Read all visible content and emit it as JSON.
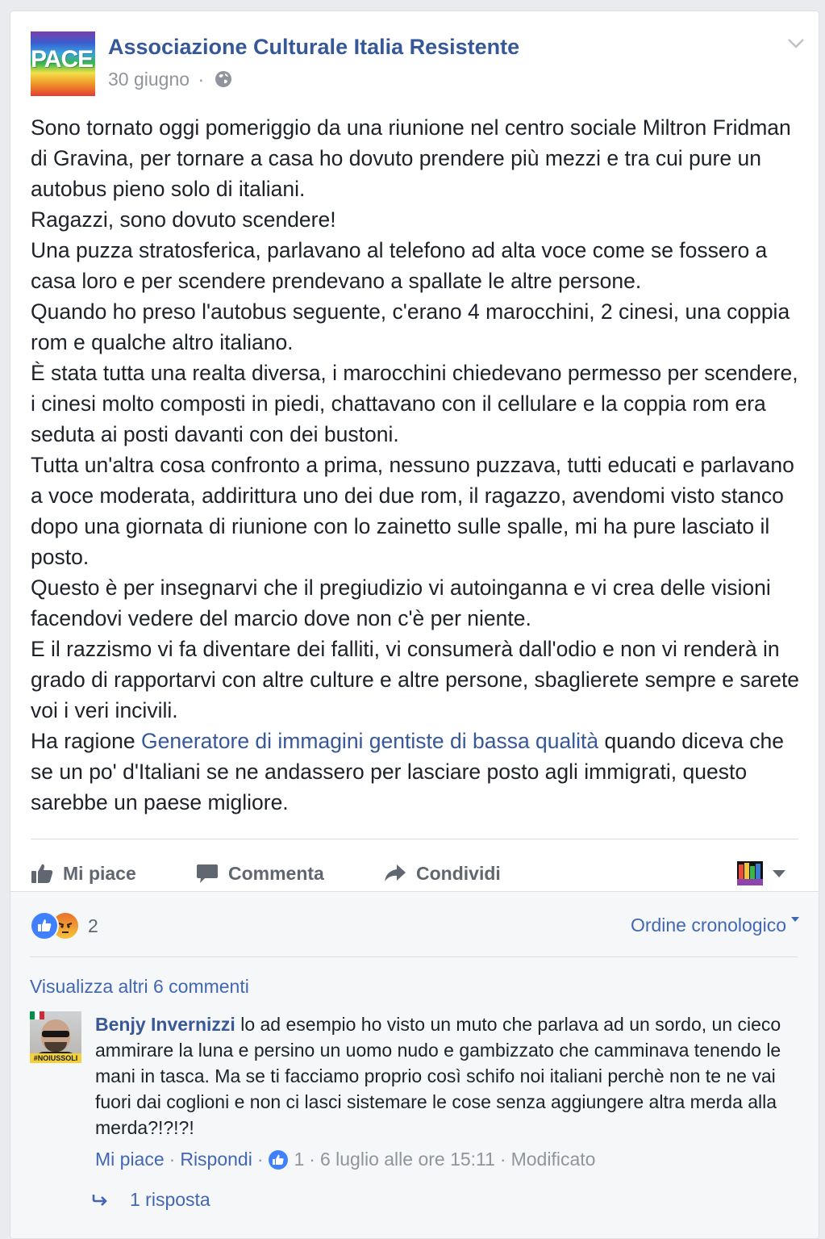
{
  "post": {
    "page_name": "Associazione Culturale Italia Resistente",
    "avatar_text": "PACE",
    "date": "30 giugno",
    "dot": "·",
    "paragraphs": [
      "Sono tornato oggi pomeriggio da una riunione nel centro sociale Miltron Fridman di Gravina, per tornare a casa ho dovuto prendere più mezzi e tra cui pure un autobus pieno solo di italiani.",
      "Ragazzi, sono dovuto scendere!",
      "Una puzza stratosferica, parlavano al telefono ad alta voce come se fossero a casa loro e per scendere prendevano a spallate le altre persone.",
      "Quando ho preso l'autobus seguente, c'erano 4 marocchini, 2 cinesi, una coppia rom e qualche altro italiano.",
      "È stata tutta una realta diversa, i marocchini chiedevano permesso per scendere, i cinesi molto composti in piedi, chattavano con il cellulare e la coppia rom era seduta ai posti davanti con dei bustoni.",
      "Tutta un'altra cosa confronto a prima, nessuno puzzava, tutti educati e parlavano a voce moderata, addirittura uno dei due rom, il ragazzo, avendomi visto stanco dopo una giornata di riunione con lo zainetto sulle spalle, mi ha pure lasciato il posto.",
      "Questo è per insegnarvi che il pregiudizio vi autoinganna e vi crea delle visioni facendovi vedere del marcio dove non c'è per niente.",
      "E il razzismo vi fa diventare dei falliti, vi consumerà dall'odio e non vi renderà in grado di rapportarvi con altre culture e altre persone, sbaglierete sempre e sarete voi i veri incivili."
    ],
    "last_paragraph": {
      "before": "Ha ragione ",
      "link": "Generatore di immagini gentiste di bassa qualità",
      "after": " quando diceva che se un po' d'Italiani se ne andassero per lasciare posto agli immigrati, questo sarebbe un paese migliore."
    }
  },
  "actions": {
    "like": "Mi piace",
    "comment": "Commenta",
    "share": "Condividi"
  },
  "reactions": {
    "count": "2",
    "order": "Ordine cronologico"
  },
  "comments_section": {
    "view_more": "Visualizza altri 6 commenti",
    "comment": {
      "author": "Benjy Invernizzi",
      "avatar_tag": "#NOIUSSOLI",
      "text": " lo ad esempio ho visto un muto che parlava ad un sordo, un cieco ammirare la luna e persino un uomo nudo e gambizzato che camminava tenendo le mani in tasca. Ma se ti facciamo proprio così schifo noi italiani perchè non te ne vai fuori dai coglioni e non ci lasci sistemare le cose senza aggiungere altra merda alla merda?!?!?!",
      "like": "Mi piace",
      "reply": "Rispondi",
      "like_count": "1",
      "timestamp": "6 luglio alle ore 15:11",
      "edited": "Modificato",
      "sep": "·"
    },
    "replies": "1 risposta"
  },
  "colors": {
    "link": "#365899",
    "accent": "#4267b2",
    "muted": "#90949c",
    "like_blue": "#4080ff"
  }
}
